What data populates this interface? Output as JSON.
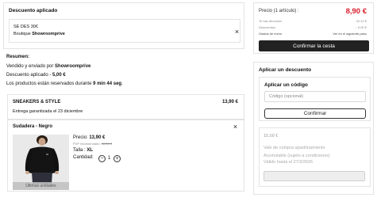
{
  "discount_panel": {
    "title": "Descuento aplicado",
    "code_line": "SE DES 30€",
    "boutique_prefix": "Boutique ",
    "boutique_name": "Showroomprive"
  },
  "summary": {
    "title": "Resumen:",
    "sold_by_prefix": "Vendido y enviado por ",
    "sold_by": "Showroomprive",
    "discount_prefix": "Descuento aplicado - ",
    "discount_value": "5,00 €",
    "reserved_prefix": "Los productos están reservados durante ",
    "reserved_time": "9 min 44 seg",
    "reserved_suffix": "."
  },
  "shipment": {
    "brand": "SNEAKERS & STYLE",
    "price": "13,90 €",
    "delivery": "Entrega garantizada el 23 diciembre"
  },
  "product": {
    "name": "Sudadera - Negro",
    "price_label": "Precio: ",
    "price": "13,90 €",
    "pvp_label": "PVP recomendado:",
    "pvp_value": "40,00 €",
    "size_label": "Talla : ",
    "size": "XL",
    "quantity_label": "Cantidad: ",
    "quantity": "1",
    "stock_badge": "Últimas unidades"
  },
  "totals": {
    "price_label": "Precio (1 artículo) :",
    "price_value": "8,90 €",
    "savings_label": "Te has ahorrado",
    "savings_value": "32,10 €",
    "discounts_label": "Descuentos",
    "discounts_value": "- 5,00 €",
    "shipping_label": "Gastos de envío",
    "shipping_value": "Ver en el siguiente paso",
    "confirm_button": "Confirmar la cesta"
  },
  "apply_discount": {
    "title": "Aplicar un descuento",
    "code_title": "Aplicar un código",
    "code_placeholder": "Código (opcional)",
    "confirm_button": "Confirmar",
    "voucher_amount": "15,00 €",
    "voucher_desc": "Vale de compra apadrinamiento",
    "voucher_cumul": "Acumulable (sujeto a condiciones)",
    "voucher_valid": "Válido hasta el 27/3/2026"
  },
  "colors": {
    "accent_red": "#d81e2a",
    "dark_button": "#222222",
    "border": "#e3e3e3"
  }
}
